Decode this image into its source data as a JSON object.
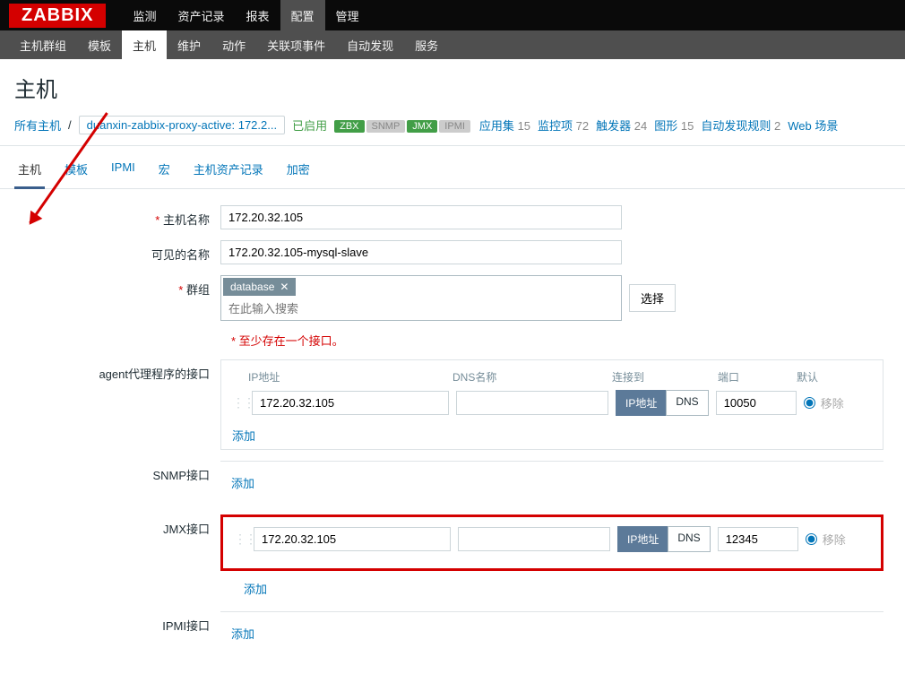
{
  "logo": "ZABBIX",
  "topnav": [
    "监测",
    "资产记录",
    "报表",
    "配置",
    "管理"
  ],
  "topnav_active": 3,
  "subnav": [
    "主机群组",
    "模板",
    "主机",
    "维护",
    "动作",
    "关联项事件",
    "自动发现",
    "服务"
  ],
  "subnav_active": 2,
  "page_title": "主机",
  "breadcrumb": {
    "all_hosts": "所有主机",
    "host_link": "duanxin-zabbix-proxy-active: 172.2...",
    "enabled": "已启用",
    "badges": {
      "zbx": "ZBX",
      "snmp": "SNMP",
      "jmx": "JMX",
      "ipmi": "IPMI"
    },
    "stats": [
      {
        "label": "应用集",
        "count": "15"
      },
      {
        "label": "监控项",
        "count": "72"
      },
      {
        "label": "触发器",
        "count": "24"
      },
      {
        "label": "图形",
        "count": "15"
      },
      {
        "label": "自动发现规则",
        "count": "2"
      },
      {
        "label": "Web 场景",
        "count": ""
      }
    ]
  },
  "tabs": [
    "主机",
    "模板",
    "IPMI",
    "宏",
    "主机资产记录",
    "加密"
  ],
  "tabs_active": 0,
  "form": {
    "hostname_label": "主机名称",
    "hostname": "172.20.32.105",
    "visible_label": "可见的名称",
    "visible": "172.20.32.105-mysql-slave",
    "groups_label": "群组",
    "group_tag": "database",
    "group_placeholder": "在此输入搜索",
    "select_btn": "选择",
    "iface_note": "* 至少存在一个接口。",
    "agent_label": "agent代理程序的接口",
    "iface_headers": {
      "ip": "IP地址",
      "dns": "DNS名称",
      "connect": "连接到",
      "port": "端口",
      "default": "默认"
    },
    "agent": {
      "ip": "172.20.32.105",
      "dns": "",
      "port": "10050"
    },
    "toggle_ip": "IP地址",
    "toggle_dns": "DNS",
    "remove": "移除",
    "add": "添加",
    "snmp_label": "SNMP接口",
    "jmx_label": "JMX接口",
    "jmx": {
      "ip": "172.20.32.105",
      "dns": "",
      "port": "12345"
    },
    "ipmi_label": "IPMI接口"
  }
}
